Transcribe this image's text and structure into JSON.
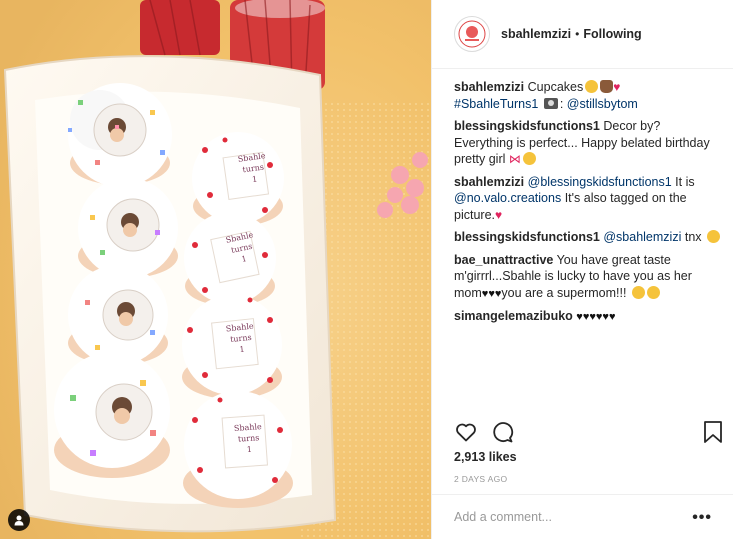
{
  "post": {
    "username": "sbahlemzizi",
    "dot": "•",
    "follow_status": "Following",
    "likes": "2,913 likes",
    "time_ago": "2 DAYS AGO",
    "comment_placeholder": "Add a comment...",
    "more_label": "•••"
  },
  "photo": {
    "cupcake_topper_text": [
      "Sbahle",
      "turns",
      "1"
    ]
  },
  "comments": [
    {
      "user": "sbahlemzizi",
      "parts": [
        "Cupcakes",
        "#SbahleTurns1",
        ":",
        "@stillsbytom"
      ]
    },
    {
      "user": "blessingskidsfunctions1",
      "text": "Decor by? Everything is perfect... Happy belated birthday pretty girl"
    },
    {
      "user": "sbahlemzizi",
      "mention1": "@blessingskidsfunctions1",
      "text1": "It is",
      "mention2": "@no.valo.creations",
      "text2": "It's also tagged on the picture."
    },
    {
      "user": "blessingskidsfunctions1",
      "mention": "@sbahlemzizi",
      "text": "tnx"
    },
    {
      "user": "bae_unattractive",
      "text1": "You have great taste m'girrrl...Sbahle is lucky to have you as her mom",
      "text2": "you are a supermom!!!"
    },
    {
      "user": "simangelemazibuko",
      "hearts": "♥♥♥♥♥♥"
    }
  ],
  "icons": {
    "heart": "heart-icon",
    "comment": "comment-icon",
    "bookmark": "bookmark-icon",
    "user_tag": "user-tag-icon"
  },
  "colors": {
    "link": "#003569",
    "text": "#262626",
    "muted": "#999999",
    "heart_red": "#e0245e",
    "border": "#efefef"
  }
}
